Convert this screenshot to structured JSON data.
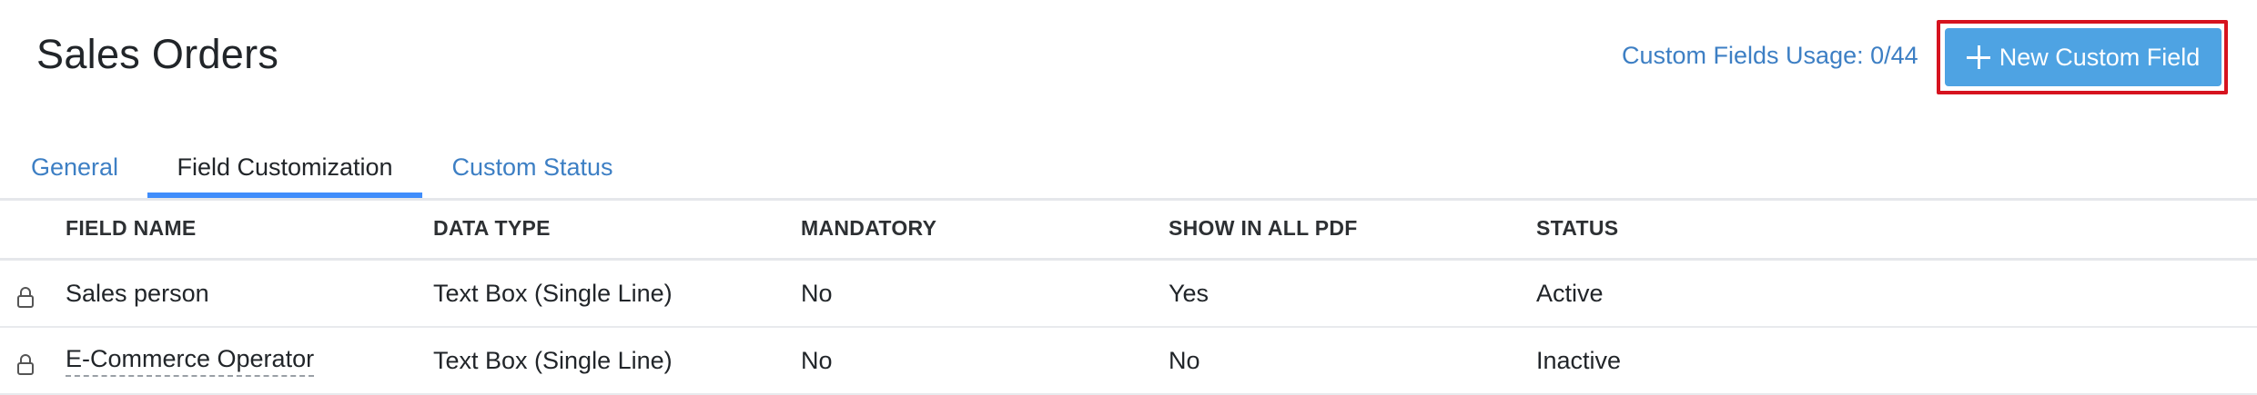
{
  "header": {
    "title": "Sales Orders",
    "usage": "Custom Fields Usage: 0/44",
    "new_button_label": "New Custom Field"
  },
  "tabs": [
    {
      "label": "General"
    },
    {
      "label": "Field Customization",
      "active": true
    },
    {
      "label": "Custom Status"
    }
  ],
  "table": {
    "columns": [
      "FIELD NAME",
      "DATA TYPE",
      "MANDATORY",
      "SHOW IN ALL PDF",
      "STATUS"
    ],
    "rows": [
      {
        "field_name": "Sales person",
        "data_type": "Text Box (Single Line)",
        "mandatory": "No",
        "show_in_pdf": "Yes",
        "status": "Active",
        "locked": true
      },
      {
        "field_name": "E-Commerce Operator",
        "data_type": "Text Box (Single Line)",
        "mandatory": "No",
        "show_in_pdf": "No",
        "status": "Inactive",
        "locked": true
      }
    ]
  },
  "colors": {
    "accent": "#408dfb",
    "button": "#4ea3e3",
    "highlight": "#d6131f"
  }
}
